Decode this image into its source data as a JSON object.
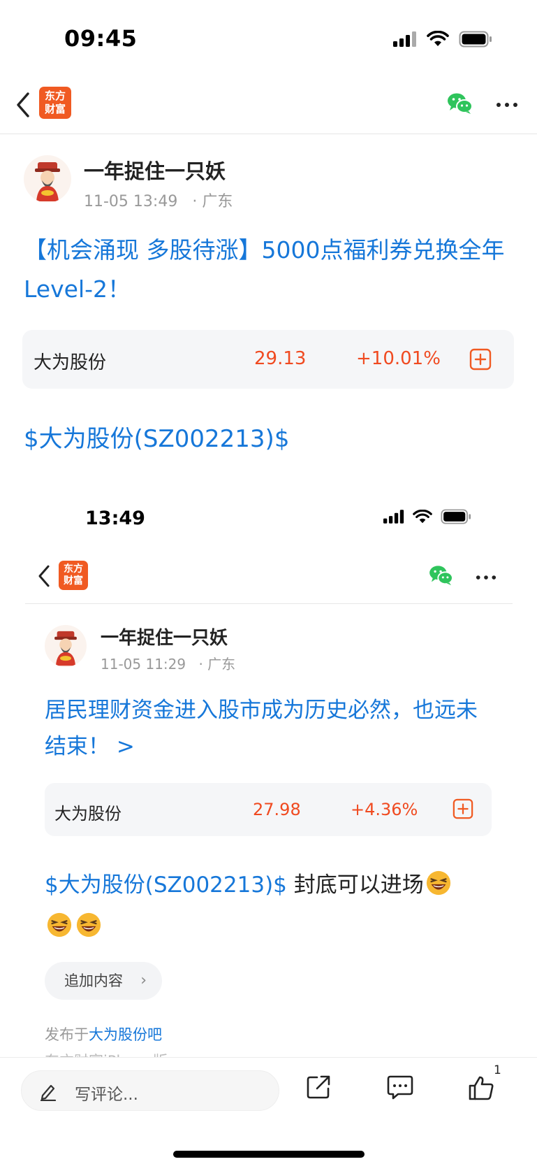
{
  "status_bar": {
    "time": "09:45"
  },
  "nav": {
    "logo_line1": "东方",
    "logo_line2": "财富"
  },
  "post": {
    "author": "一年捉住一只妖",
    "date": "11-05 13:49",
    "location": "· 广东",
    "title": "【机会涌现 多股待涨】5000点福利券兑换全年Level-2！",
    "stock": {
      "name": "大为股份",
      "price": "29.13",
      "change": "+10.01%"
    },
    "stock_tag": "$大为股份(SZ002213)$"
  },
  "embedded": {
    "status_time": "13:49",
    "logo_line1": "东方",
    "logo_line2": "财富",
    "author": "一年捉住一只妖",
    "date": "11-05 11:29",
    "location": "· 广东",
    "title": "居民理财资金进入股市成为历史必然，也远未结束！ >",
    "stock": {
      "name": "大为股份",
      "price": "27.98",
      "change": "+4.36%"
    },
    "stock_tag": "$大为股份(SZ002213)$",
    "body_text": " 封底可以进场",
    "append_label": "追加内容",
    "posted_prefix": "发布于",
    "posted_bar": "大为股份吧",
    "cut_text": "东方财富iPhone版"
  },
  "bottom_bar": {
    "comment_placeholder": "写评论...",
    "like_count": "1"
  },
  "colors": {
    "brand": "#f05a22",
    "link": "#1677d9",
    "up": "#f04a20",
    "wechat": "#2fc45c"
  }
}
